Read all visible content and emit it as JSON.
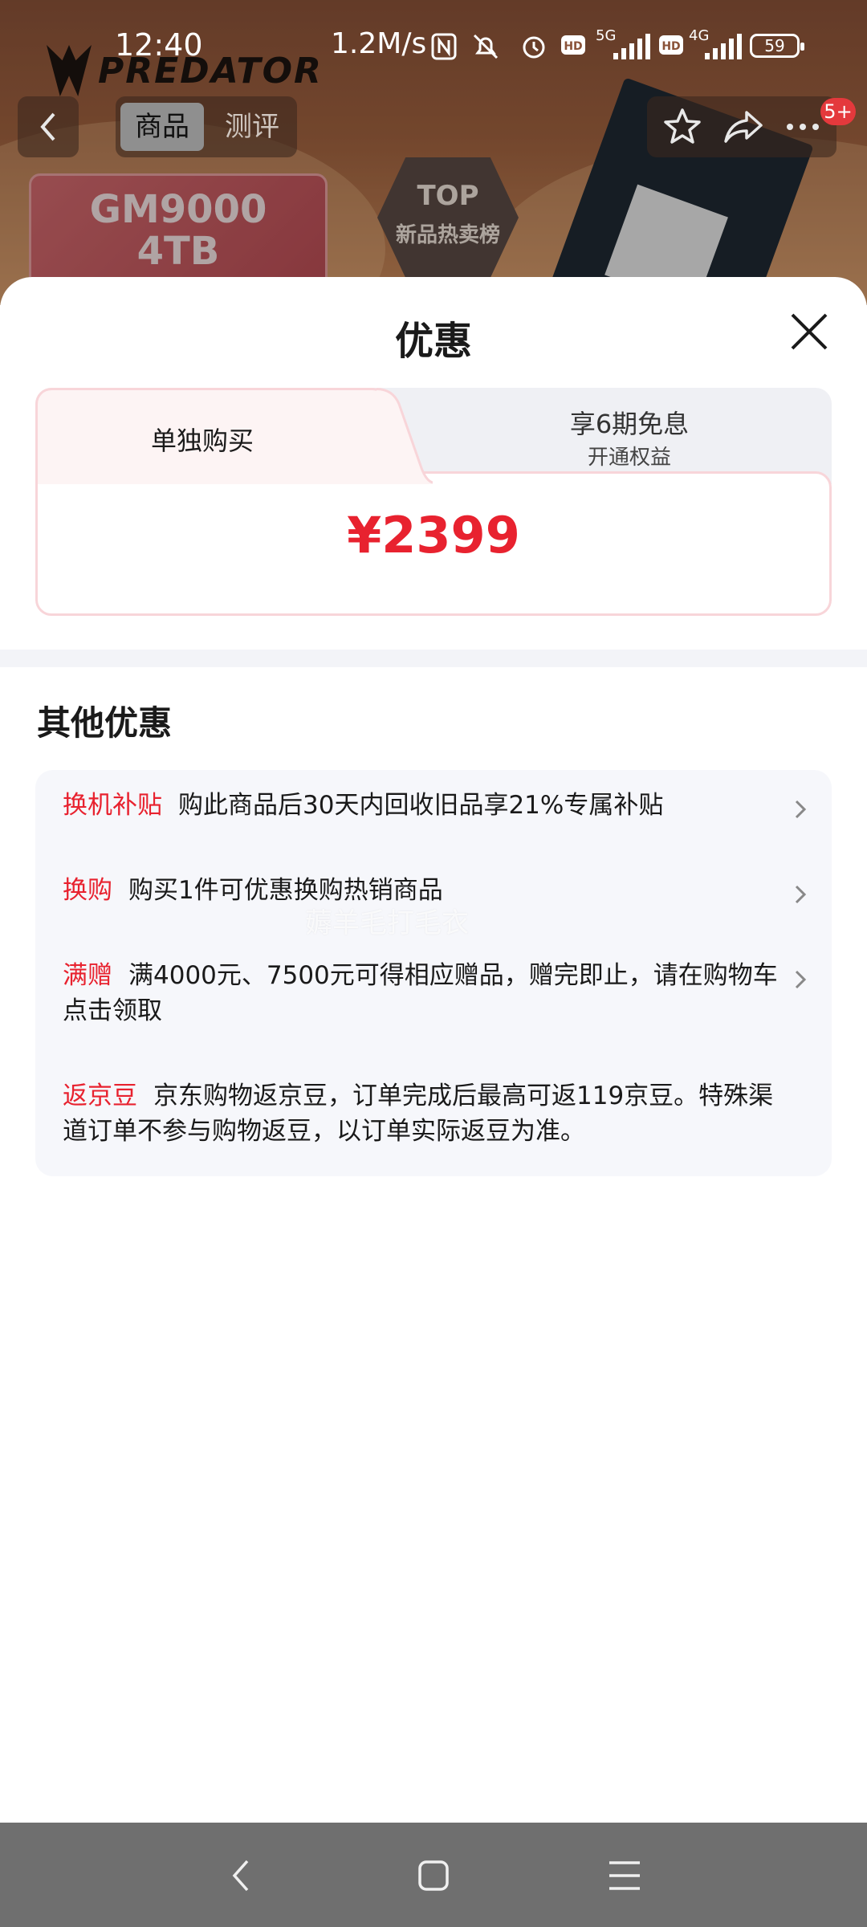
{
  "status_bar": {
    "time": "12:40",
    "network_speed": "1.2M/s",
    "sim1_tag": "5G",
    "sim2_tag": "4G",
    "hd_label": "HD",
    "battery": "59"
  },
  "banner": {
    "brand": "PREDATOR",
    "tabs": [
      "商品",
      "测评"
    ],
    "active_tab": "商品",
    "message_badge": "5+",
    "product_model": "GM9000",
    "product_capacity": "4TB",
    "top_badge_title": "TOP",
    "top_badge_sub": "新品热卖榜"
  },
  "sheet": {
    "title": "优惠",
    "options": {
      "left_label": "单独购买",
      "right_title": "享6期免息",
      "right_sub": "开通权益"
    },
    "price": "¥2399",
    "other_title": "其他优惠",
    "promotions": [
      {
        "tag": "换机补贴",
        "text": "购此商品后30天内回收旧品享21%专属补贴",
        "has_chevron": true
      },
      {
        "tag": "换购",
        "text": "购买1件可优惠换购热销商品",
        "has_chevron": true
      },
      {
        "tag": "满赠",
        "text": "满4000元、7500元可得相应赠品，赠完即止，请在购物车点击领取",
        "has_chevron": true
      },
      {
        "tag": "返京豆",
        "text": "京东购物返京豆，订单完成后最高可返119京豆。特殊渠道订单不参与购物返豆，以订单实际返豆为准。",
        "has_chevron": false
      }
    ],
    "watermark": "薅羊毛打毛衣"
  },
  "colors": {
    "accent_red": "#e8222f",
    "nav_bar": "#6f6f6f"
  }
}
